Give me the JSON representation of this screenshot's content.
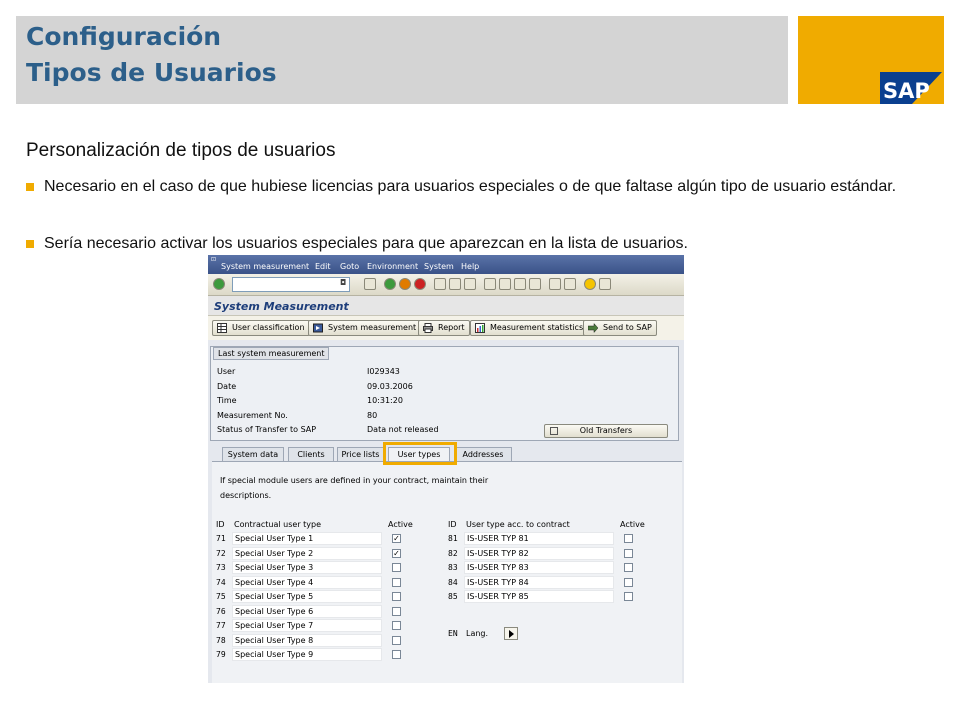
{
  "slide": {
    "title_line1": "Configuración",
    "title_line2": "Tipos de Usuarios",
    "logo_text": "SAP",
    "subtitle": "Personalización de tipos de usuarios",
    "bullets": [
      " Necesario en el caso de que hubiese licencias para usuarios especiales o de que faltase algún tipo de usuario estándar.",
      "Sería necesario activar los usuarios especiales para que aparezcan en la lista de usuarios."
    ],
    "colors": {
      "title": "#2c5f8a",
      "title_bg": "#d4d4d4",
      "accent": "#f0ab00"
    }
  },
  "sap": {
    "menu": [
      "System measurement",
      "Edit",
      "Goto",
      "Environment",
      "System",
      "Help"
    ],
    "screen_title": "System Measurement",
    "app_toolbar": [
      {
        "label": "User classification",
        "icon": "table-icon"
      },
      {
        "label": "System measurement",
        "icon": "execute-icon"
      },
      {
        "label": "Report",
        "icon": "printer-icon"
      },
      {
        "label": "Measurement statistics",
        "icon": "statistics-icon"
      },
      {
        "label": "Send to SAP",
        "icon": "send-icon"
      }
    ],
    "last_measurement": {
      "title": "Last system measurement",
      "fields": [
        {
          "label": "User",
          "value": "I029343"
        },
        {
          "label": "Date",
          "value": "09.03.2006"
        },
        {
          "label": "Time",
          "value": "10:31:20"
        },
        {
          "label": "Measurement No.",
          "value": "80"
        },
        {
          "label": "Status of Transfer to SAP",
          "value": "Data not released"
        }
      ],
      "old_transfers_label": "Old Transfers"
    },
    "tabs": [
      "System data",
      "Clients",
      "Price lists",
      "User types",
      "Addresses"
    ],
    "active_tab": "User types",
    "description_line1": "If special module users are defined in your contract, maintain their",
    "description_line2": "descriptions.",
    "left_table": {
      "headers": {
        "id": "ID",
        "type": "Contractual user type",
        "active": "Active"
      },
      "rows": [
        {
          "id": "71",
          "type": "Special User Type 1",
          "active": true
        },
        {
          "id": "72",
          "type": "Special User Type 2",
          "active": true
        },
        {
          "id": "73",
          "type": "Special User Type 3",
          "active": false
        },
        {
          "id": "74",
          "type": "Special User Type 4",
          "active": false
        },
        {
          "id": "75",
          "type": "Special User Type 5",
          "active": false
        },
        {
          "id": "76",
          "type": "Special User Type 6",
          "active": false
        },
        {
          "id": "77",
          "type": "Special User Type 7",
          "active": false
        },
        {
          "id": "78",
          "type": "Special User Type 8",
          "active": false
        },
        {
          "id": "79",
          "type": "Special User Type 9",
          "active": false
        }
      ]
    },
    "right_table": {
      "headers": {
        "id": "ID",
        "type": "User type acc. to contract",
        "active": "Active"
      },
      "rows": [
        {
          "id": "81",
          "type": "IS-USER TYP 81",
          "active": false
        },
        {
          "id": "82",
          "type": "IS-USER TYP 82",
          "active": false
        },
        {
          "id": "83",
          "type": "IS-USER TYP 83",
          "active": false
        },
        {
          "id": "84",
          "type": "IS-USER TYP 84",
          "active": false
        },
        {
          "id": "85",
          "type": "IS-USER TYP 85",
          "active": false
        }
      ]
    },
    "lang": {
      "id": "EN",
      "label": "Lang."
    }
  }
}
